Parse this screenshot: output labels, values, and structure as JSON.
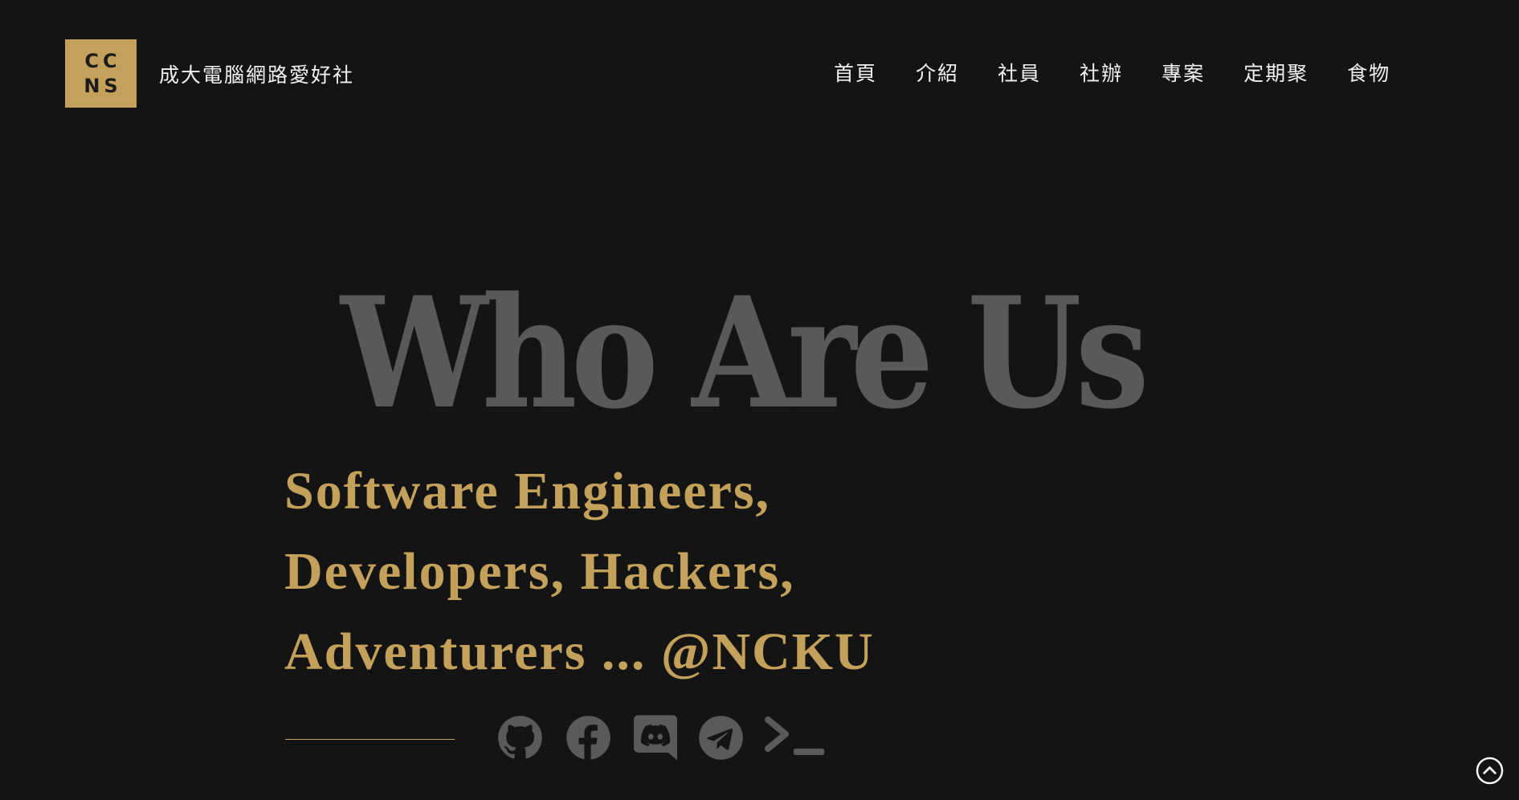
{
  "header": {
    "logo_line1": "CC",
    "logo_line2": "NS",
    "site_title": "成大電腦網路愛好社",
    "nav": [
      {
        "label": "首頁"
      },
      {
        "label": "介紹"
      },
      {
        "label": "社員"
      },
      {
        "label": "社辦"
      },
      {
        "label": "專案"
      },
      {
        "label": "定期聚"
      },
      {
        "label": "食物"
      }
    ]
  },
  "hero": {
    "title": "Who Are Us",
    "tagline": [
      "Software Engineers,",
      "Developers, Hackers,",
      "Adventurers ... @NCKU"
    ]
  },
  "social": [
    {
      "icon": "github-icon"
    },
    {
      "icon": "facebook-icon"
    },
    {
      "icon": "discord-icon"
    },
    {
      "icon": "telegram-icon"
    },
    {
      "icon": "terminal-icon"
    }
  ],
  "back_to_top": {
    "icon": "chevron-up-circle-icon"
  },
  "colors": {
    "background": "#141414",
    "accent": "#c4a15a",
    "title": "#595959",
    "icon": "#5a5a5a",
    "nav_text": "#f2f2f2"
  }
}
